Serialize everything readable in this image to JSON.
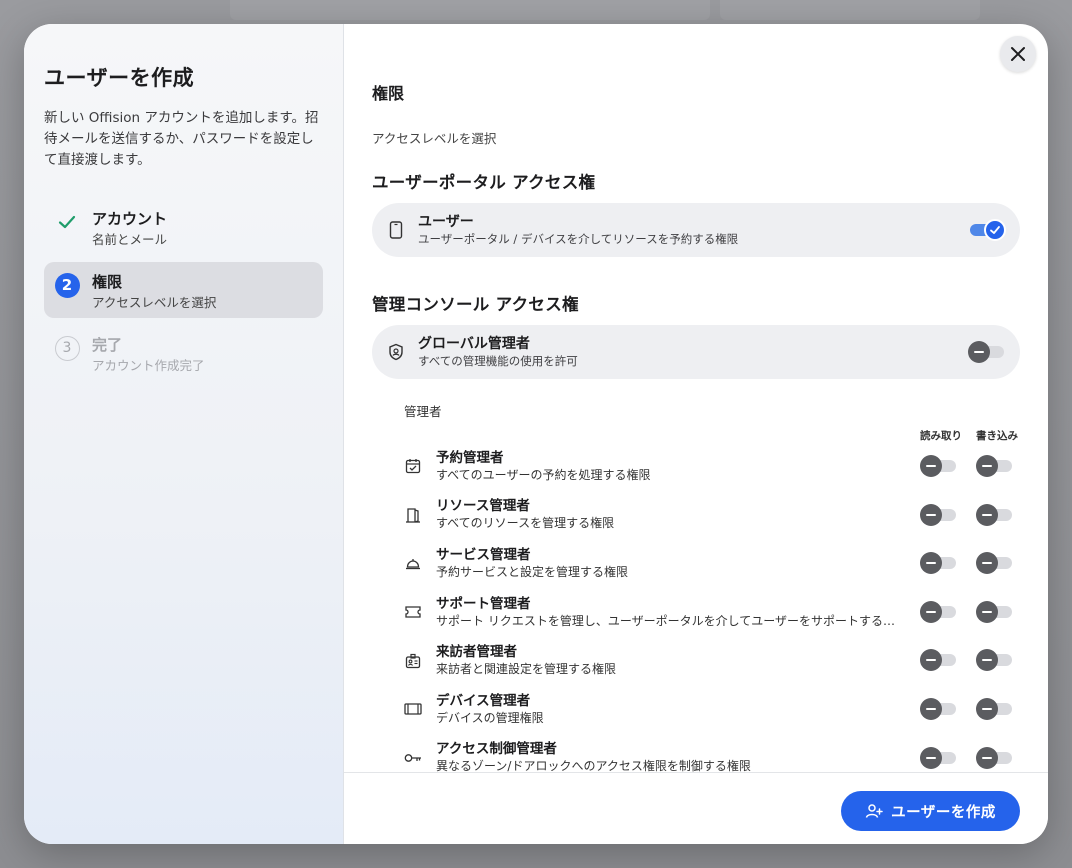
{
  "dialog": {
    "title": "ユーザーを作成",
    "description": "新しい Offision アカウントを追加します。招待メールを送信するか、パスワードを設定して直接渡します。"
  },
  "steps": [
    {
      "number": "1",
      "title": "アカウント",
      "subtitle": "名前とメール",
      "state": "done"
    },
    {
      "number": "2",
      "title": "権限",
      "subtitle": "アクセスレベルを選択",
      "state": "active"
    },
    {
      "number": "3",
      "title": "完了",
      "subtitle": "アカウント作成完了",
      "state": "pending"
    }
  ],
  "main": {
    "title": "権限",
    "subtitle": "アクセスレベルを選択",
    "user_portal": {
      "heading": "ユーザーポータル アクセス権",
      "item": {
        "title": "ユーザー",
        "subtitle": "ユーザーポータル / デバイスを介してリソースを予約する権限",
        "enabled": true,
        "icon": "phone-icon"
      }
    },
    "admin_console": {
      "heading": "管理コンソール アクセス権",
      "global": {
        "title": "グローバル管理者",
        "subtitle": "すべての管理機能の使用を許可",
        "enabled": false,
        "icon": "shield-icon"
      },
      "admins_label": "管理者",
      "col_read": "読み取り",
      "col_write": "書き込み",
      "roles": [
        {
          "title": "予約管理者",
          "subtitle": "すべてのユーザーの予約を処理する権限",
          "icon": "calendar-check-icon",
          "read": false,
          "write": false
        },
        {
          "title": "リソース管理者",
          "subtitle": "すべてのリソースを管理する権限",
          "icon": "door-icon",
          "read": false,
          "write": false
        },
        {
          "title": "サービス管理者",
          "subtitle": "予約サービスと設定を管理する権限",
          "icon": "service-bell-icon",
          "read": false,
          "write": false
        },
        {
          "title": "サポート管理者",
          "subtitle": "サポート リクエストを管理し、ユーザーポータルを介してユーザーをサポートする権限",
          "icon": "ticket-icon",
          "read": false,
          "write": false
        },
        {
          "title": "来訪者管理者",
          "subtitle": "来訪者と関連設定を管理する権限",
          "icon": "visitor-badge-icon",
          "read": false,
          "write": false
        },
        {
          "title": "デバイス管理者",
          "subtitle": "デバイスの管理権限",
          "icon": "device-icon",
          "read": false,
          "write": false
        },
        {
          "title": "アクセス制御管理者",
          "subtitle": "異なるゾーン/ドアロックへのアクセス権限を制御する権限",
          "icon": "key-icon",
          "read": false,
          "write": false
        }
      ]
    }
  },
  "footer": {
    "create_label": "ユーザーを作成"
  },
  "colors": {
    "accent": "#2563eb",
    "check": "#1f9d6b"
  }
}
